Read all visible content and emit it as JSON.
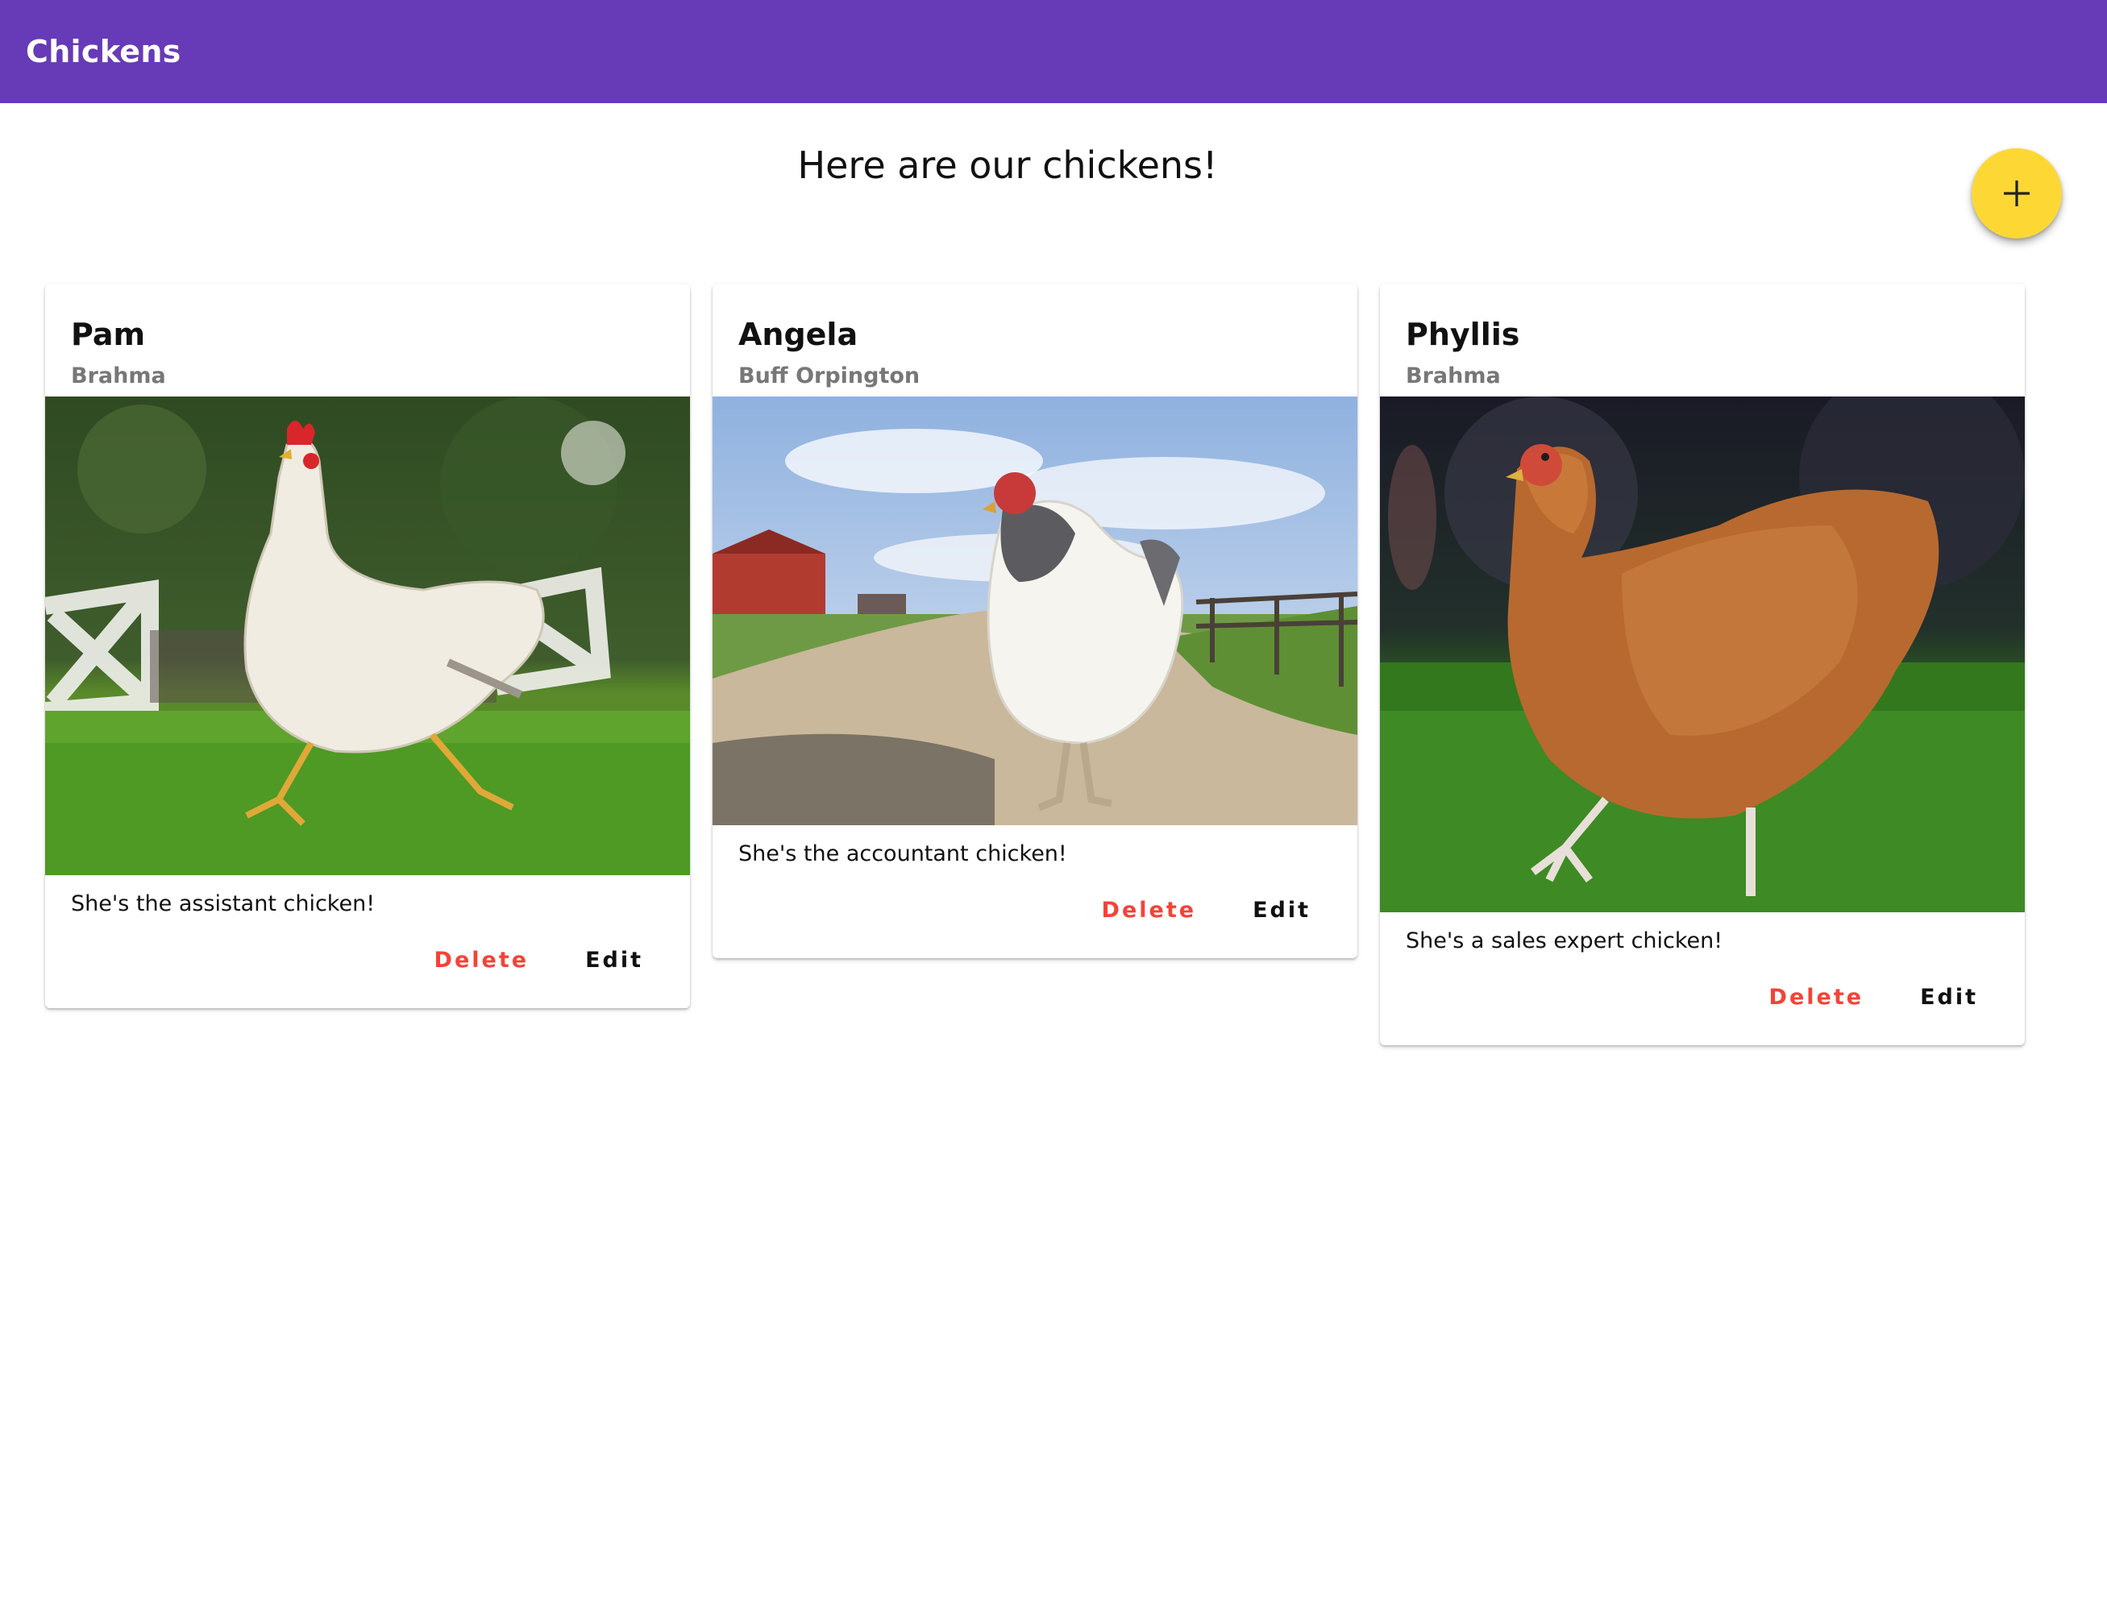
{
  "app": {
    "title": "Chickens"
  },
  "heading": "Here are our chickens!",
  "fab": {
    "icon": "plus-icon",
    "color": "#fdd835"
  },
  "colors": {
    "app_bar": "#673ab7",
    "delete": "#f44336"
  },
  "cards": [
    {
      "name": "Pam",
      "breed": "Brahma",
      "description": "She's the assistant chicken!",
      "delete_label": "Delete",
      "edit_label": "Edit"
    },
    {
      "name": "Angela",
      "breed": "Buff Orpington",
      "description": "She's the accountant chicken!",
      "delete_label": "Delete",
      "edit_label": "Edit"
    },
    {
      "name": "Phyllis",
      "breed": "Brahma",
      "description": "She's a sales expert chicken!",
      "delete_label": "Delete",
      "edit_label": "Edit"
    }
  ]
}
